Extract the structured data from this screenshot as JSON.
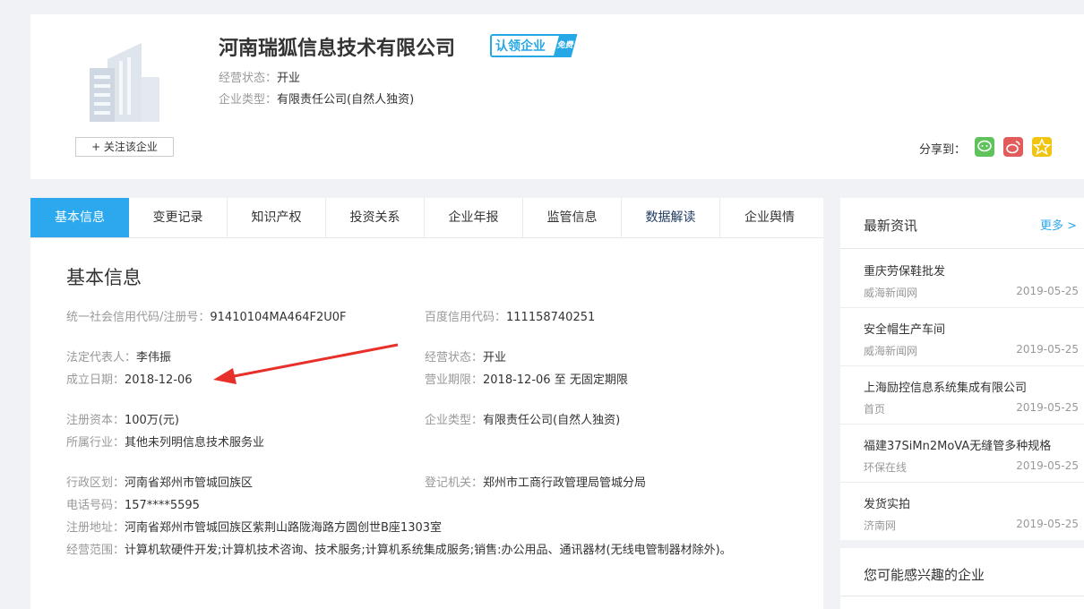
{
  "company": {
    "name": "河南瑞狐信息技术有限公司",
    "claim_badge": "认领企业",
    "claim_tag": "免费",
    "status_label": "经营状态：",
    "status_value": "开业",
    "type_label": "企业类型：",
    "type_value": "有限责任公司(自然人独资)",
    "follow_button": "+ 关注该企业",
    "share_label": "分享到："
  },
  "tabs": [
    {
      "label": "基本信息"
    },
    {
      "label": "变更记录"
    },
    {
      "label": "知识产权"
    },
    {
      "label": "投资关系"
    },
    {
      "label": "企业年报"
    },
    {
      "label": "监管信息"
    },
    {
      "label": "数据解读"
    },
    {
      "label": "企业舆情"
    }
  ],
  "basic": {
    "title": "基本信息",
    "credit_code_label": "统一社会信用代码/注册号：",
    "credit_code": "91410104MA464F2U0F",
    "baidu_code_label": "百度信用代码：",
    "baidu_code": "111158740251",
    "legal_rep_label": "法定代表人：",
    "legal_rep": "李伟振",
    "status_label": "经营状态：",
    "status": "开业",
    "founded_label": "成立日期：",
    "founded": "2018-12-06",
    "term_label": "营业期限：",
    "term": "2018-12-06 至 无固定期限",
    "capital_label": "注册资本：",
    "capital": "100万(元)",
    "type_label": "企业类型：",
    "type": "有限责任公司(自然人独资)",
    "industry_label": "所属行业：",
    "industry": "其他未列明信息技术服务业",
    "district_label": "行政区划：",
    "district": "河南省郑州市管城回族区",
    "authority_label": "登记机关：",
    "authority": "郑州市工商行政管理局管城分局",
    "phone_label": "电话号码：",
    "phone": "157****5595",
    "address_label": "注册地址：",
    "address": "河南省郑州市管城回族区紫荆山路陇海路方圆创世B座1303室",
    "scope_label": "经营范围：",
    "scope": "计算机软硬件开发;计算机技术咨询、技术服务;计算机系统集成服务;销售:办公用品、通讯器材(无线电管制器材除外)。"
  },
  "news": {
    "title": "最新资讯",
    "more": "更多 >",
    "items": [
      {
        "title": "重庆劳保鞋批发",
        "source": "威海新闻网",
        "date": "2019-05-25"
      },
      {
        "title": "安全帽生产车间",
        "source": "威海新闻网",
        "date": "2019-05-25"
      },
      {
        "title": "上海励控信息系统集成有限公司",
        "source": "首页",
        "date": "2019-05-25"
      },
      {
        "title": "福建37SiMn2MoVA无缝管多种规格",
        "source": "环保在线",
        "date": "2019-05-25"
      },
      {
        "title": "发货实拍",
        "source": "济南网",
        "date": "2019-05-25"
      }
    ]
  },
  "interest": {
    "title": "您可能感兴趣的企业"
  },
  "colors": {
    "accent": "#2ba8ee",
    "annotation_arrow": "#e8302b"
  }
}
